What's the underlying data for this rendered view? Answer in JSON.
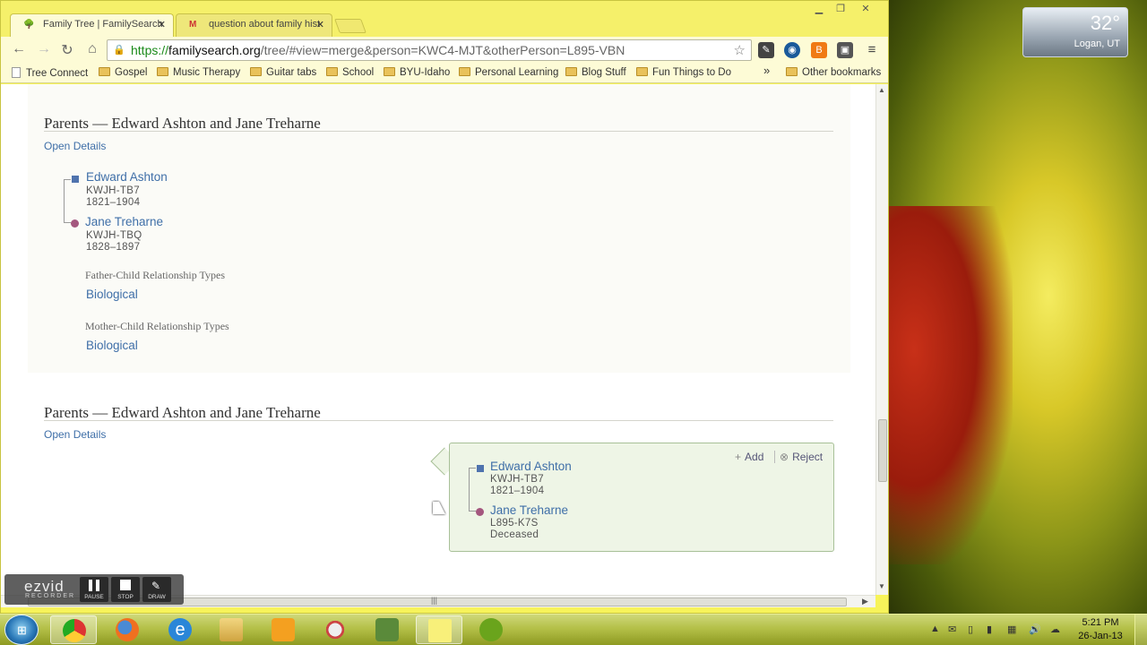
{
  "desktop": {
    "weather": {
      "temp": "32°",
      "city": "Logan, UT"
    }
  },
  "browser": {
    "tabs": [
      {
        "label": "Family Tree | FamilySearch",
        "active": true
      },
      {
        "label": "question about family hist",
        "active": false
      }
    ],
    "url": {
      "scheme": "https://",
      "host": "familysearch.org",
      "path": "/tree/#view=merge&person=KWC4-MJT&otherPerson=L895-VBN"
    },
    "bookmarks": [
      {
        "label": "Tree Connect",
        "type": "page"
      },
      {
        "label": "Gospel",
        "type": "folder"
      },
      {
        "label": "Music Therapy",
        "type": "folder"
      },
      {
        "label": "Guitar tabs",
        "type": "folder"
      },
      {
        "label": "School",
        "type": "folder"
      },
      {
        "label": "BYU-Idaho",
        "type": "folder"
      },
      {
        "label": "Personal Learning",
        "type": "folder"
      },
      {
        "label": "Blog Stuff",
        "type": "folder"
      },
      {
        "label": "Fun Things to Do",
        "type": "folder"
      }
    ],
    "bookmarks_overflow": "»",
    "other_bookmarks": "Other bookmarks"
  },
  "page": {
    "section1": {
      "title": "Parents — Edward Ashton and Jane Treharne",
      "open_details": "Open Details",
      "father": {
        "name": "Edward Ashton",
        "id": "KWJH-TB7",
        "dates": "1821–1904"
      },
      "mother": {
        "name": "Jane Treharne",
        "id": "KWJH-TBQ",
        "dates": "1828–1897"
      },
      "father_rel_label": "Father-Child Relationship Types",
      "father_rel_value": "Biological",
      "mother_rel_label": "Mother-Child Relationship Types",
      "mother_rel_value": "Biological"
    },
    "section2": {
      "title": "Parents — Edward Ashton and Jane Treharne",
      "open_details": "Open Details",
      "add_label": "Add",
      "reject_label": "Reject",
      "father": {
        "name": "Edward Ashton",
        "id": "KWJH-TB7",
        "dates": "1821–1904"
      },
      "mother": {
        "name": "Jane Treharne",
        "id": "L895-K7S",
        "dates": "Deceased"
      }
    }
  },
  "recorder": {
    "logo": "ezvid",
    "sub": "RECORDER",
    "buttons": [
      "PAUSE",
      "STOP",
      "DRAW"
    ]
  },
  "taskbar": {
    "time": "5:21 PM",
    "date": "26-Jan-13"
  },
  "colors": {
    "link": "#3f6fa8",
    "male_marker": "#4f73ae",
    "female_marker": "#a4567e",
    "callout_bg": "#eef5e6"
  }
}
